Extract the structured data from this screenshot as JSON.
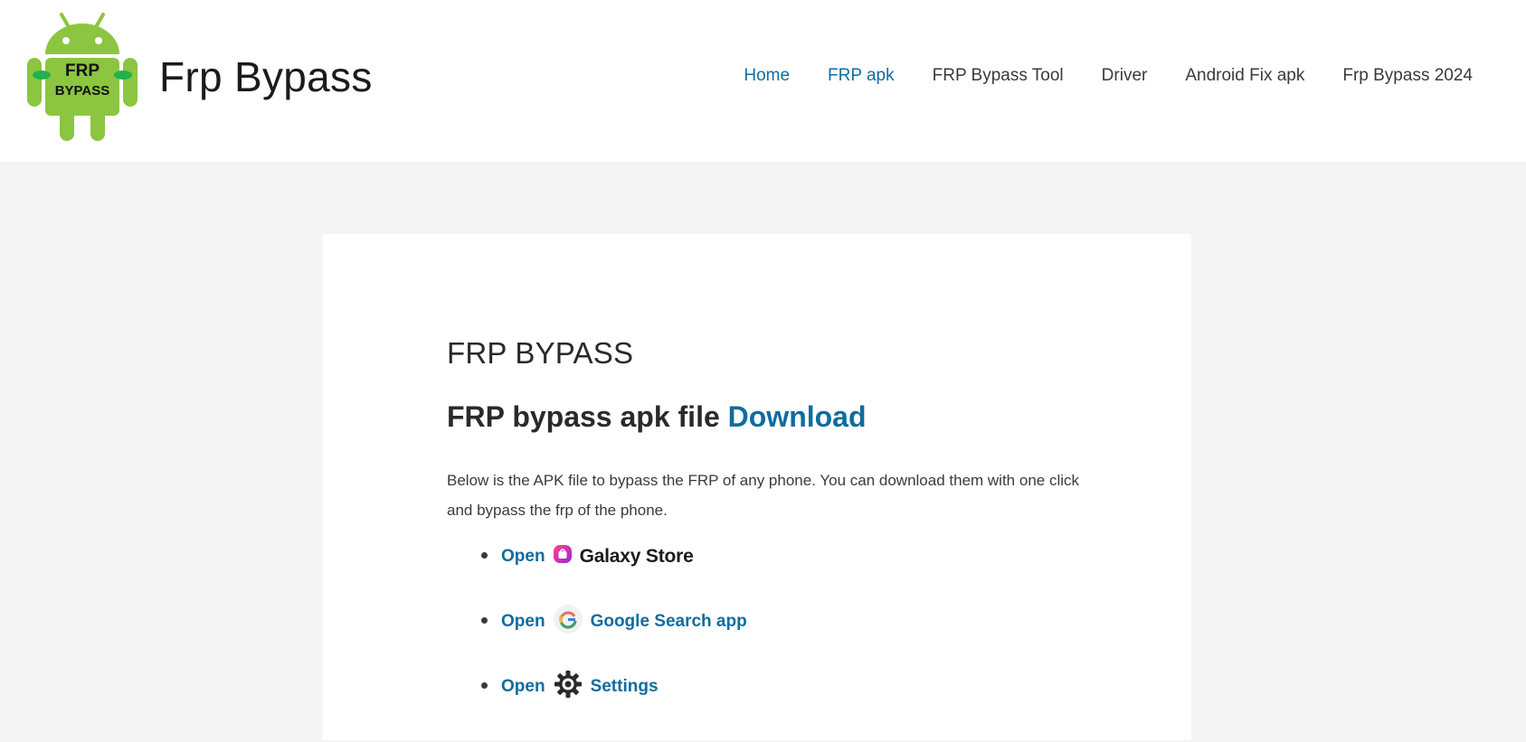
{
  "header": {
    "logo_text_top": "FRP",
    "logo_text_bottom": "BYPASS",
    "site_title": "Frp Bypass"
  },
  "nav": {
    "items": [
      {
        "label": "Home",
        "active": true
      },
      {
        "label": "FRP apk",
        "active": true
      },
      {
        "label": "FRP Bypass Tool",
        "active": false
      },
      {
        "label": "Driver",
        "active": false
      },
      {
        "label": "Android Fix apk",
        "active": false
      },
      {
        "label": "Frp Bypass 2024",
        "active": false
      }
    ]
  },
  "main": {
    "page_title": "FRP BYPASS",
    "subhead_text": "FRP bypass apk file ",
    "subhead_link": "Download",
    "intro": "Below is the APK file to bypass the FRP of any phone. You can download them with one click and bypass the frp of the phone.",
    "links": [
      {
        "open": "Open",
        "label": "Galaxy Store",
        "icon": "galaxy-store-icon"
      },
      {
        "open": "Open",
        "label": "Google Search app",
        "icon": "google-g-icon"
      },
      {
        "open": "Open",
        "label": "Settings",
        "icon": "gear-icon"
      }
    ]
  },
  "colors": {
    "link": "#0f6c9e",
    "android_green": "#8cc53f",
    "page_bg": "#f4f4f4"
  }
}
